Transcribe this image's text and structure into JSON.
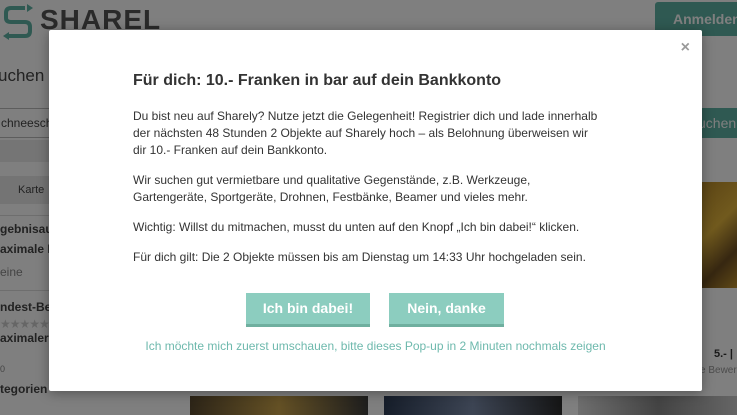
{
  "header": {
    "logo_text": "SHAREL",
    "login_label": "Anmelden"
  },
  "search": {
    "heading": "uchen u",
    "input_value": "chneesch",
    "button_label": "uchen"
  },
  "sidebar": {
    "tab_map": "Karte",
    "filter_results": "gebnisaus",
    "max_distance": "aximale Di",
    "none_option": "eine",
    "min_rating": "ndest-Bew",
    "max_price": "aximaler P",
    "tiny_value": "0",
    "categories": "tegorien"
  },
  "card": {
    "price": "5.- |",
    "rating_text": "e Bewer"
  },
  "modal": {
    "title": "Für dich: 10.- Franken in bar auf dein Bankkonto",
    "paragraphs": [
      "Du bist neu auf Sharely? Nutze jetzt die Gelegenheit! Registrier dich und lade innerhalb der nächsten 48 Stunden 2 Objekte auf Sharely hoch – als Belohnung überweisen wir dir 10.- Franken auf dein Bankkonto.",
      "Wir suchen gut vermietbare und qualitative Gegenstände, z.B. Werkzeuge, Gartengeräte, Sportgeräte, Drohnen, Festbänke, Beamer und vieles mehr.",
      "Wichtig: Willst du mitmachen, musst du unten auf den Knopf „Ich bin dabei!“ klicken.",
      "Für dich gilt: Die 2 Objekte müssen bis am Dienstag um 14:33 Uhr hochgeladen sein."
    ],
    "accept_label": "Ich bin dabei!",
    "decline_label": "Nein, danke",
    "later_link": "Ich möchte mich zuerst umschauen, bitte dieses Pop-up in 2 Minuten nochmals zeigen",
    "close_symbol": "×"
  },
  "colors": {
    "brand": "#5fb3a4",
    "button": "#8ccdbf",
    "link": "#6eb9ad"
  }
}
